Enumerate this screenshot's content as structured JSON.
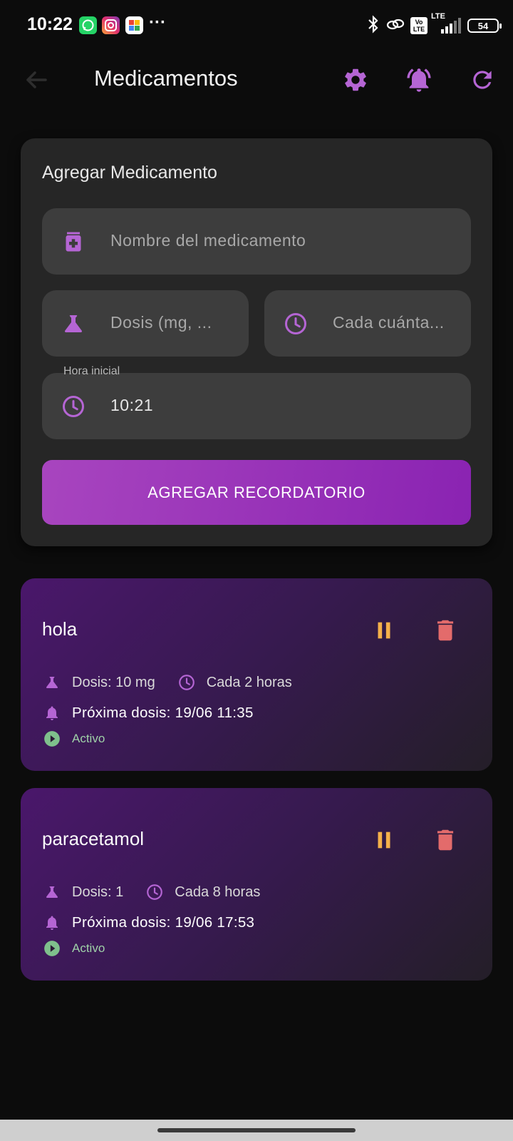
{
  "status_bar": {
    "time": "10:22",
    "overflow_dots": "···",
    "battery": "54",
    "network": "LTE",
    "volte": "Vo LTE",
    "app_icons": [
      "whatsapp-icon",
      "instagram-icon",
      "photos-icon"
    ]
  },
  "app_bar": {
    "title": "Medicamentos",
    "actions": [
      "settings-icon",
      "notifications-icon",
      "refresh-icon"
    ]
  },
  "add_form": {
    "title": "Agregar Medicamento",
    "name_placeholder": "Nombre del medicamento",
    "dose_placeholder": "Dosis (mg, ...",
    "interval_placeholder": "Cada cuánta...",
    "start_time_label": "Hora inicial",
    "start_time_value": "10:21",
    "submit_label": "AGREGAR RECORDATORIO"
  },
  "medications": [
    {
      "name": "hola",
      "dose": "Dosis: 10 mg",
      "interval": "Cada 2 horas",
      "next_dose": "Próxima dosis: 19/06 11:35",
      "status": "Activo"
    },
    {
      "name": "paracetamol",
      "dose": "Dosis: 1",
      "interval": "Cada 8 horas",
      "next_dose": "Próxima dosis: 19/06 17:53",
      "status": "Activo"
    }
  ],
  "colors": {
    "accent": "#b565d4",
    "pause": "#f5b14a",
    "delete": "#e36b6b",
    "active": "#7fc08c",
    "background": "#0c0c0c",
    "card": "#262626",
    "field": "#3d3d3d"
  }
}
